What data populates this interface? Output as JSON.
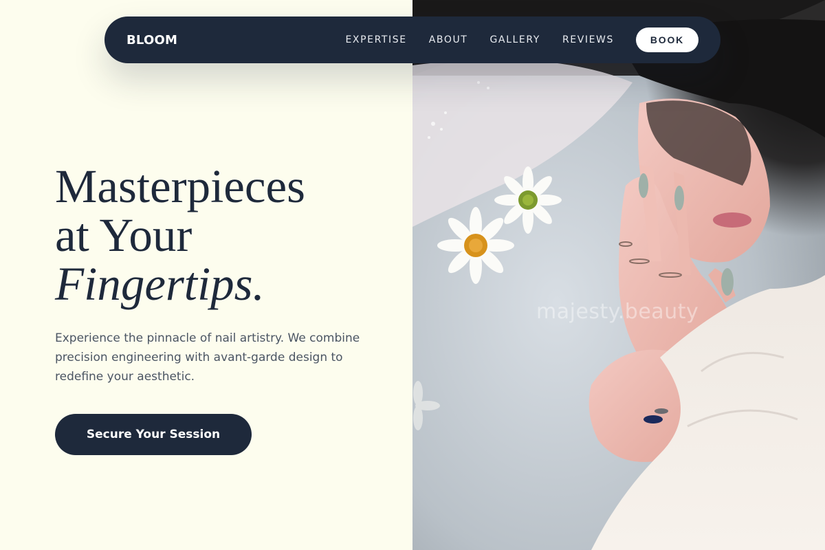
{
  "nav": {
    "brand": "BLOOM",
    "links": [
      {
        "label": "EXPERTISE"
      },
      {
        "label": "ABOUT"
      },
      {
        "label": "GALLERY"
      },
      {
        "label": "REVIEWS"
      }
    ],
    "book_label": "BOOK"
  },
  "hero": {
    "title_line1": "Masterpieces",
    "title_line2": "at Your",
    "title_line3": "Fingertips.",
    "description": "Experience the pinnacle of nail artistry. We combine precision engineering with avant-garde design to redefine your aesthetic.",
    "cta_label": "Secure Your Session"
  },
  "photo": {
    "watermark": "majesty.beauty",
    "subject": "woman in milk bath with daisies"
  },
  "colors": {
    "background": "#fdfdee",
    "navy": "#1e293b",
    "text_muted": "#4b5563",
    "white": "#ffffff"
  }
}
